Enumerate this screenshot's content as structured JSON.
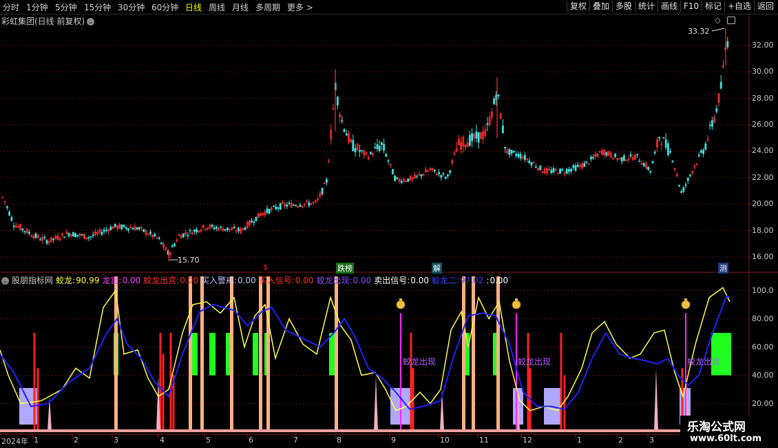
{
  "toolbar": {
    "timeframes": [
      {
        "label": "分时",
        "active": false
      },
      {
        "label": "1分钟",
        "active": false
      },
      {
        "label": "5分钟",
        "active": false
      },
      {
        "label": "15分钟",
        "active": false
      },
      {
        "label": "30分钟",
        "active": false
      },
      {
        "label": "60分钟",
        "active": false
      },
      {
        "label": "日线",
        "active": true
      },
      {
        "label": "周线",
        "active": false
      },
      {
        "label": "月线",
        "active": false
      },
      {
        "label": "多周期",
        "active": false
      },
      {
        "label": "更多 >",
        "active": false
      }
    ],
    "right_buttons": [
      "复权",
      "叠加",
      "多股",
      "统计",
      "画线",
      "F10",
      "标记",
      "+自选",
      "返回"
    ]
  },
  "main_chart": {
    "title": "彩虹集团(日线 前复权)",
    "y_ticks": [
      "32.00",
      "30.00",
      "28.00",
      "26.00",
      "24.00",
      "22.00",
      "20.00",
      "18.00",
      "16.00"
    ],
    "high_label": "33.32",
    "low_label": "15.70",
    "badges": [
      {
        "text": "$",
        "color": "#ff2020"
      },
      {
        "text": "跌榜",
        "color": "#2a8a2a"
      },
      {
        "text": "解",
        "color": "#1c6a7a"
      },
      {
        "text": "测",
        "color": "#2a4a9a"
      }
    ]
  },
  "indicator": {
    "name": "股朋指标网",
    "fields": [
      {
        "label": "蛟龙:",
        "value": "90.99",
        "color": "#ffff40"
      },
      {
        "label": "龙宫:",
        "value": "0.00",
        "color": "#ff40ff"
      },
      {
        "label": "蛟龙出宫:",
        "value": "0.00",
        "color": "#ff3030"
      },
      {
        "label": "买入警戒:",
        "value": "0.00",
        "color": "#c0c0ff"
      },
      {
        "label": "买入信号:",
        "value": "0.00",
        "color": "#ff3030"
      },
      {
        "label": "蛟龙出现:",
        "value": "0.00",
        "color": "#8a4aff"
      },
      {
        "label": "卖出信号:",
        "value": "0.00",
        "color": "#ffffff"
      },
      {
        "label": "蛟龙二:",
        "value": "97.02",
        "color": "#4040ff"
      },
      {
        "label": ":",
        "value": "0.00",
        "color": "#ffffff"
      }
    ],
    "y_ticks": [
      "100.0",
      "80.00",
      "60.00",
      "40.00",
      "20.00"
    ],
    "signal_labels": [
      "蛟龙出现",
      "蛟龙出现",
      "蛟龙出现"
    ]
  },
  "date_axis": {
    "labels": [
      "2024年",
      "1",
      "2",
      "3",
      "4",
      "5",
      "6",
      "7",
      "8",
      "9",
      "10",
      "11",
      "12",
      "1",
      "2",
      "3"
    ]
  },
  "watermark": {
    "line1": "乐淘公式网",
    "line2": "www.60lt.com"
  },
  "colors": {
    "up": "#ff3030",
    "down": "#40e0e0",
    "yellow_line": "#ffff40",
    "blue_line": "#2020ff",
    "orange_bar": "#ffb080",
    "green_box": "#20ff20",
    "lavender_box": "#b0a8ff",
    "magenta": "#ff20ff"
  }
}
